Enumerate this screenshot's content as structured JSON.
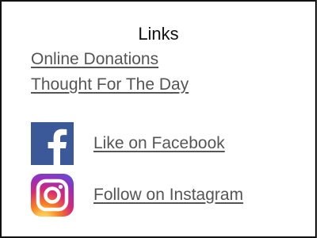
{
  "links_panel": {
    "title": "Links",
    "items": [
      {
        "label": "Online Donations"
      },
      {
        "label": "Thought For The Day"
      }
    ],
    "social": [
      {
        "icon": "facebook-icon",
        "label": "Like on Facebook",
        "color": "#3b5998"
      },
      {
        "icon": "instagram-icon",
        "label": "Follow on Instagram",
        "colors": [
          "#feda75",
          "#fa7e1e",
          "#d62976",
          "#962fbf",
          "#4f5bd5"
        ]
      }
    ]
  }
}
